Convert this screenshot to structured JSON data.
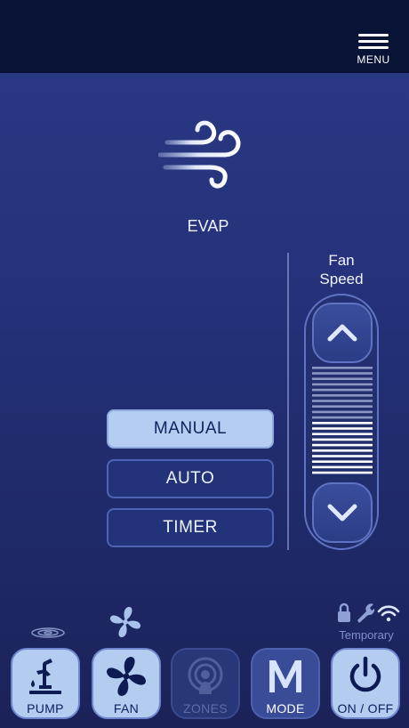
{
  "header": {
    "menu_label": "MENU"
  },
  "current_mode": {
    "label": "EVAP",
    "icon": "wind-icon"
  },
  "fan_speed": {
    "title_line1": "Fan",
    "title_line2": "Speed",
    "up_icon": "chevron-up-icon",
    "down_icon": "chevron-down-icon",
    "level_fraction": 0.5
  },
  "control_modes": [
    {
      "label": "MANUAL",
      "active": true
    },
    {
      "label": "AUTO",
      "active": false
    },
    {
      "label": "TIMER",
      "active": false
    }
  ],
  "status": {
    "fan_running_icon": "fan-icon",
    "pump_running_icon": "water-ripple-icon",
    "icons": [
      "lock-icon",
      "wrench-icon",
      "wifi-icon"
    ],
    "connection_label": "Temporary"
  },
  "bottom_nav": [
    {
      "label": "PUMP",
      "icon": "pump-icon",
      "state": "active"
    },
    {
      "label": "FAN",
      "icon": "fan-icon",
      "state": "active"
    },
    {
      "label": "ZONES",
      "icon": "zones-icon",
      "state": "disabled"
    },
    {
      "label": "MODE",
      "icon": "mode-m-icon",
      "state": "normal"
    },
    {
      "label": "ON / OFF",
      "icon": "power-icon",
      "state": "active"
    }
  ],
  "colors": {
    "background": "#26337c",
    "topbar": "#081336",
    "active_button": "#b4cdf0",
    "button": "#23337a",
    "border": "#5f73c2"
  }
}
